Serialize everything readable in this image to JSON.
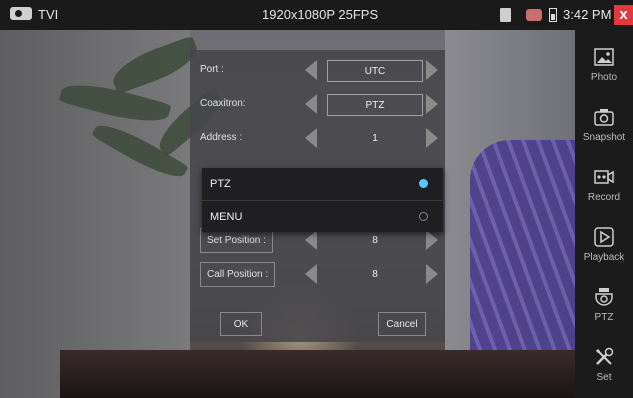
{
  "status_bar": {
    "mode": "TVI",
    "resolution": "1920x1080P 25FPS",
    "time": "3:42 PM",
    "close_label": "x"
  },
  "sidebar": {
    "items": [
      {
        "label": "Photo",
        "icon": "photo-icon"
      },
      {
        "label": "Snapshot",
        "icon": "camera-icon"
      },
      {
        "label": "Record",
        "icon": "record-icon"
      },
      {
        "label": "Playback",
        "icon": "play-icon"
      },
      {
        "label": "PTZ",
        "icon": "ptz-dome-icon"
      },
      {
        "label": "Set",
        "icon": "tools-icon"
      }
    ]
  },
  "dialog": {
    "rows": [
      {
        "label": "Port :",
        "value": "UTC"
      },
      {
        "label": "Coaxitron:",
        "value": "PTZ"
      },
      {
        "label": "Address :",
        "value": "1"
      },
      {
        "label": "Set Position :",
        "value": "8"
      },
      {
        "label": "Call Position :",
        "value": "8"
      }
    ],
    "ok_label": "OK",
    "cancel_label": "Cancel"
  },
  "popup": {
    "options": [
      {
        "label": "PTZ",
        "selected": true
      },
      {
        "label": "MENU",
        "selected": false
      }
    ]
  },
  "colors": {
    "accent": "#5bc8ff",
    "close": "#e0393e"
  }
}
